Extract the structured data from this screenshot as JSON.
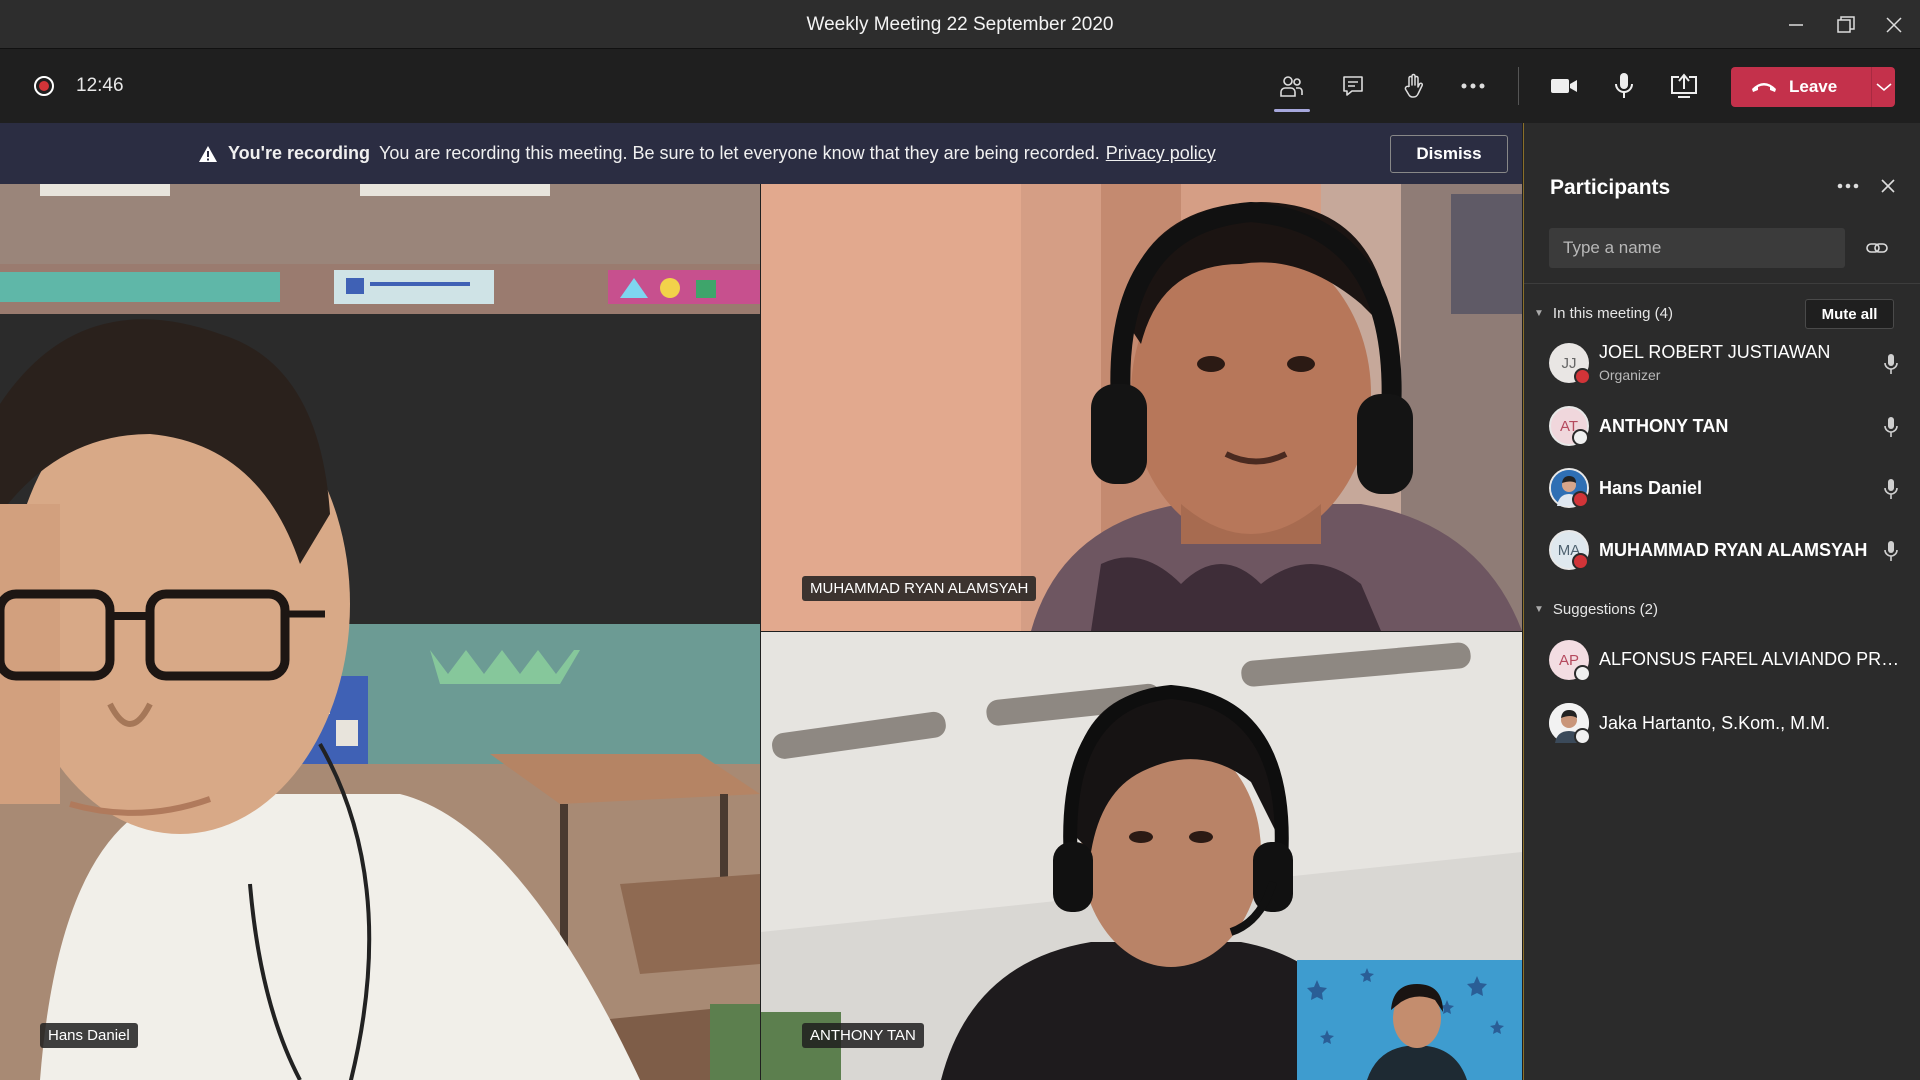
{
  "window": {
    "title": "Weekly Meeting 22 September 2020"
  },
  "toolbar": {
    "timer": "12:46",
    "leave_label": "Leave"
  },
  "banner": {
    "heading": "You're recording",
    "message": "You are recording this meeting. Be sure to let everyone know that they are being recorded.",
    "link": "Privacy policy",
    "dismiss_label": "Dismiss"
  },
  "videos": [
    {
      "name": "Hans Daniel"
    },
    {
      "name": "MUHAMMAD RYAN ALAMSYAH"
    },
    {
      "name": "ANTHONY TAN"
    }
  ],
  "panel": {
    "title": "Participants",
    "search_placeholder": "Type a name",
    "in_meeting_label": "In this meeting (4)",
    "mute_all_label": "Mute all",
    "suggestions_label": "Suggestions (2)",
    "participants": [
      {
        "initials": "JJ",
        "name": "JOEL ROBERT JUSTIAWAN",
        "role": "Organizer"
      },
      {
        "initials": "AT",
        "name": "ANTHONY TAN"
      },
      {
        "initials": "",
        "name": "Hans Daniel"
      },
      {
        "initials": "MA",
        "name": "MUHAMMAD RYAN ALAMSYAH"
      }
    ],
    "suggestions": [
      {
        "initials": "AP",
        "name": "ALFONSUS FAREL ALVIANDO PRATA..."
      },
      {
        "initials": "",
        "name": "Jaka Hartanto, S.Kom., M.M."
      }
    ]
  },
  "colors": {
    "leave": "#c4314b",
    "recording": "#d13438",
    "banner_bg": "#2b2d42",
    "panel_bg": "#2b2b2b"
  }
}
